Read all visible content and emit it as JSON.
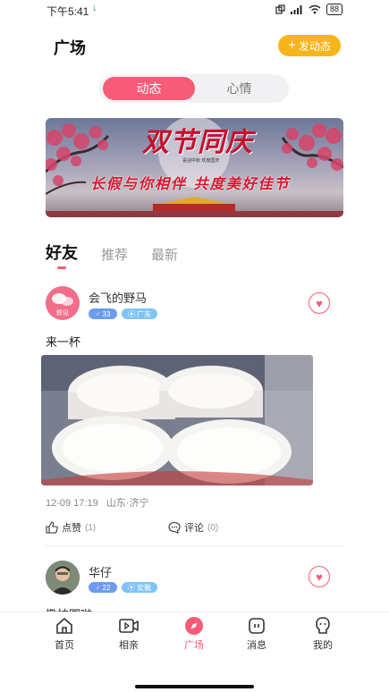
{
  "status_bar": {
    "time": "下午5:41",
    "download_icon": "download-arrow-icon",
    "battery": "88"
  },
  "header": {
    "title": "广场",
    "post_button": "发动态",
    "post_icon": "plus-icon"
  },
  "segment": {
    "tabs": [
      "动态",
      "心情"
    ],
    "active": 0
  },
  "banner": {
    "title": "双节同庆",
    "subtitle": "喜迎中秋 欢度国庆",
    "slogan": "长假与你相伴 共度美好佳节"
  },
  "feed_tabs": {
    "items": [
      "好友",
      "推荐",
      "最新"
    ],
    "active": 0
  },
  "posts": [
    {
      "avatar_text": "即见",
      "username": "会飞的野马",
      "gender_symbol": "♂",
      "age": "33",
      "location": "广东",
      "text": "来一杯",
      "time": "12-09 17:19",
      "place": "山东·济宁",
      "like_label": "点赞",
      "like_count": "(1)",
      "comment_label": "评论",
      "comment_count": "(0)"
    },
    {
      "username": "华仔",
      "gender_symbol": "♂",
      "age": "22",
      "location": "安徽",
      "text": "撒拉圆啦"
    }
  ],
  "tabbar": {
    "items": [
      "首页",
      "相亲",
      "广场",
      "消息",
      "我的"
    ],
    "active": 2
  },
  "colors": {
    "accent": "#f65b77",
    "button_yellow": "#f7b51c",
    "gender_blue": "#6b9cf0",
    "location_blue": "#7fc4f7"
  }
}
